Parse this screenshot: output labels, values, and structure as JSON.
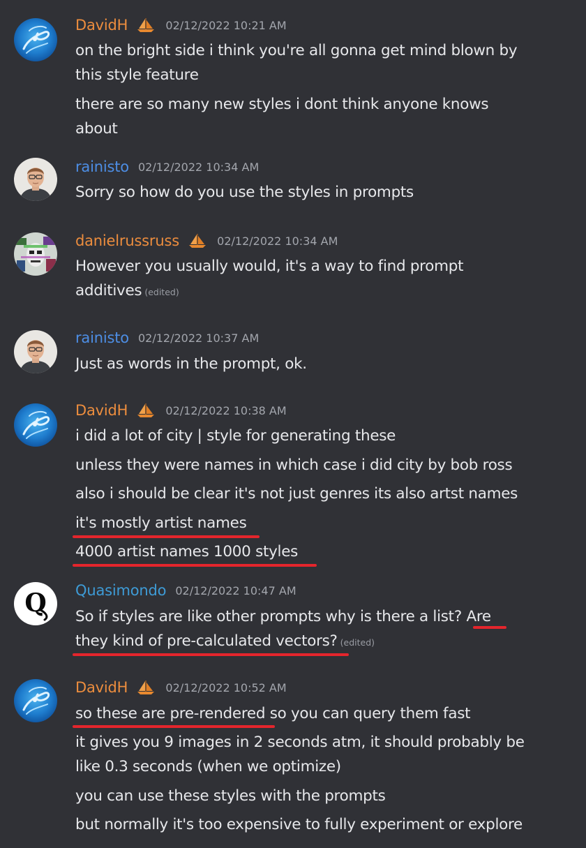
{
  "messages": [
    {
      "author": "DavidH",
      "avatar_icon": "swirl-avatar-icon",
      "badge_icon": "sailboat-icon",
      "timestamp": "02/12/2022 10:21 AM",
      "lines": [
        "on the bright side i think you're all gonna get mind blown by",
        "this style feature",
        "there are so many new styles i dont think anyone knows",
        "about"
      ]
    },
    {
      "author": "rainisto",
      "avatar_icon": "person-photo-avatar-icon",
      "timestamp": "02/12/2022 10:34 AM",
      "lines": [
        "Sorry so how do you use the styles in prompts"
      ]
    },
    {
      "author": "danielrussruss",
      "avatar_icon": "glitch-art-avatar-icon",
      "badge_icon": "sailboat-icon",
      "timestamp": "02/12/2022 10:34 AM",
      "lines": [
        "However you usually would, it's a way to find prompt",
        "additives"
      ],
      "edited": "(edited)"
    },
    {
      "author": "rainisto",
      "avatar_icon": "person-photo-avatar-icon",
      "timestamp": "02/12/2022 10:37 AM",
      "lines": [
        "Just as words in the prompt, ok."
      ]
    },
    {
      "author": "DavidH",
      "avatar_icon": "swirl-avatar-icon",
      "badge_icon": "sailboat-icon",
      "timestamp": "02/12/2022 10:38 AM",
      "lines": [
        "i did a lot of city | style for generating these",
        "unless they were names in which case i did city by bob ross",
        "also i should be clear it's not just genres its also artst names",
        "it's mostly artist names",
        "4000 artist names 1000 styles"
      ]
    },
    {
      "author": "Quasimondo",
      "avatar_icon": "q-logo-avatar-icon",
      "timestamp": "02/12/2022 10:47 AM",
      "lines": [
        "So if styles are like other prompts why is there a list? Are",
        "they kind of pre-calculated vectors?"
      ],
      "edited": "(edited)"
    },
    {
      "author": "DavidH",
      "avatar_icon": "swirl-avatar-icon",
      "badge_icon": "sailboat-icon",
      "timestamp": "02/12/2022 10:52 AM",
      "lines": [
        "so these are pre-rendered so you can query them fast",
        "it gives you 9 images in 2 seconds atm, it should probably be",
        "like 0.3 seconds (when we optimize)",
        "you can use these styles with the prompts",
        "but normally it's too expensive to fully experiment or explore"
      ]
    }
  ],
  "colors": {
    "background": "#303136",
    "author_orange": "#ec8d3e",
    "author_blue": "#4d8ee5",
    "author_quasimondo": "#3e9bd6",
    "timestamp": "#a3a6ad",
    "underline_annotation": "#e4252c"
  }
}
